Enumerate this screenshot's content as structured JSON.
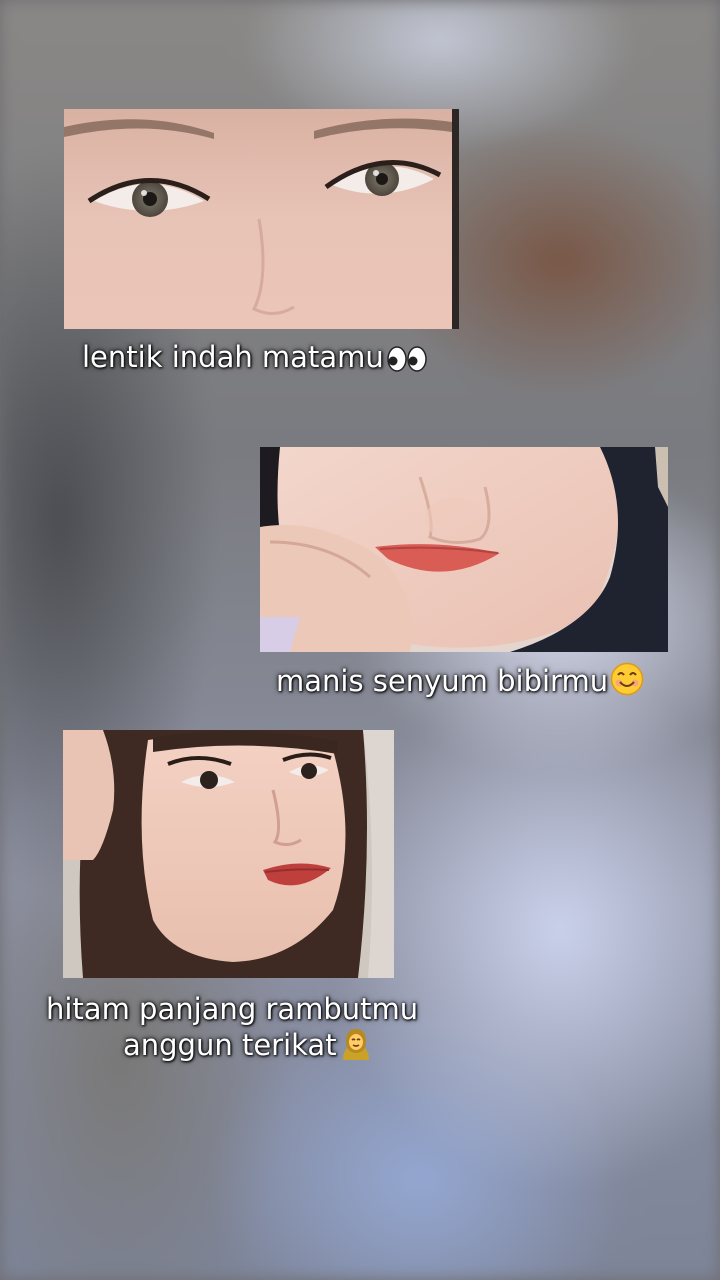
{
  "captions": {
    "eyes": "lentik indah matamu",
    "smile": "manis senyum bibirmu",
    "hair_line1": "hitam panjang rambutmu",
    "hair_line2": "anggun terikat"
  },
  "icons": [
    "eyes-emoji",
    "smiling-face-emoji",
    "person-with-headscarf-emoji"
  ],
  "colors": {
    "caption_text": "#ffffff",
    "caption_outline": "#000000"
  }
}
